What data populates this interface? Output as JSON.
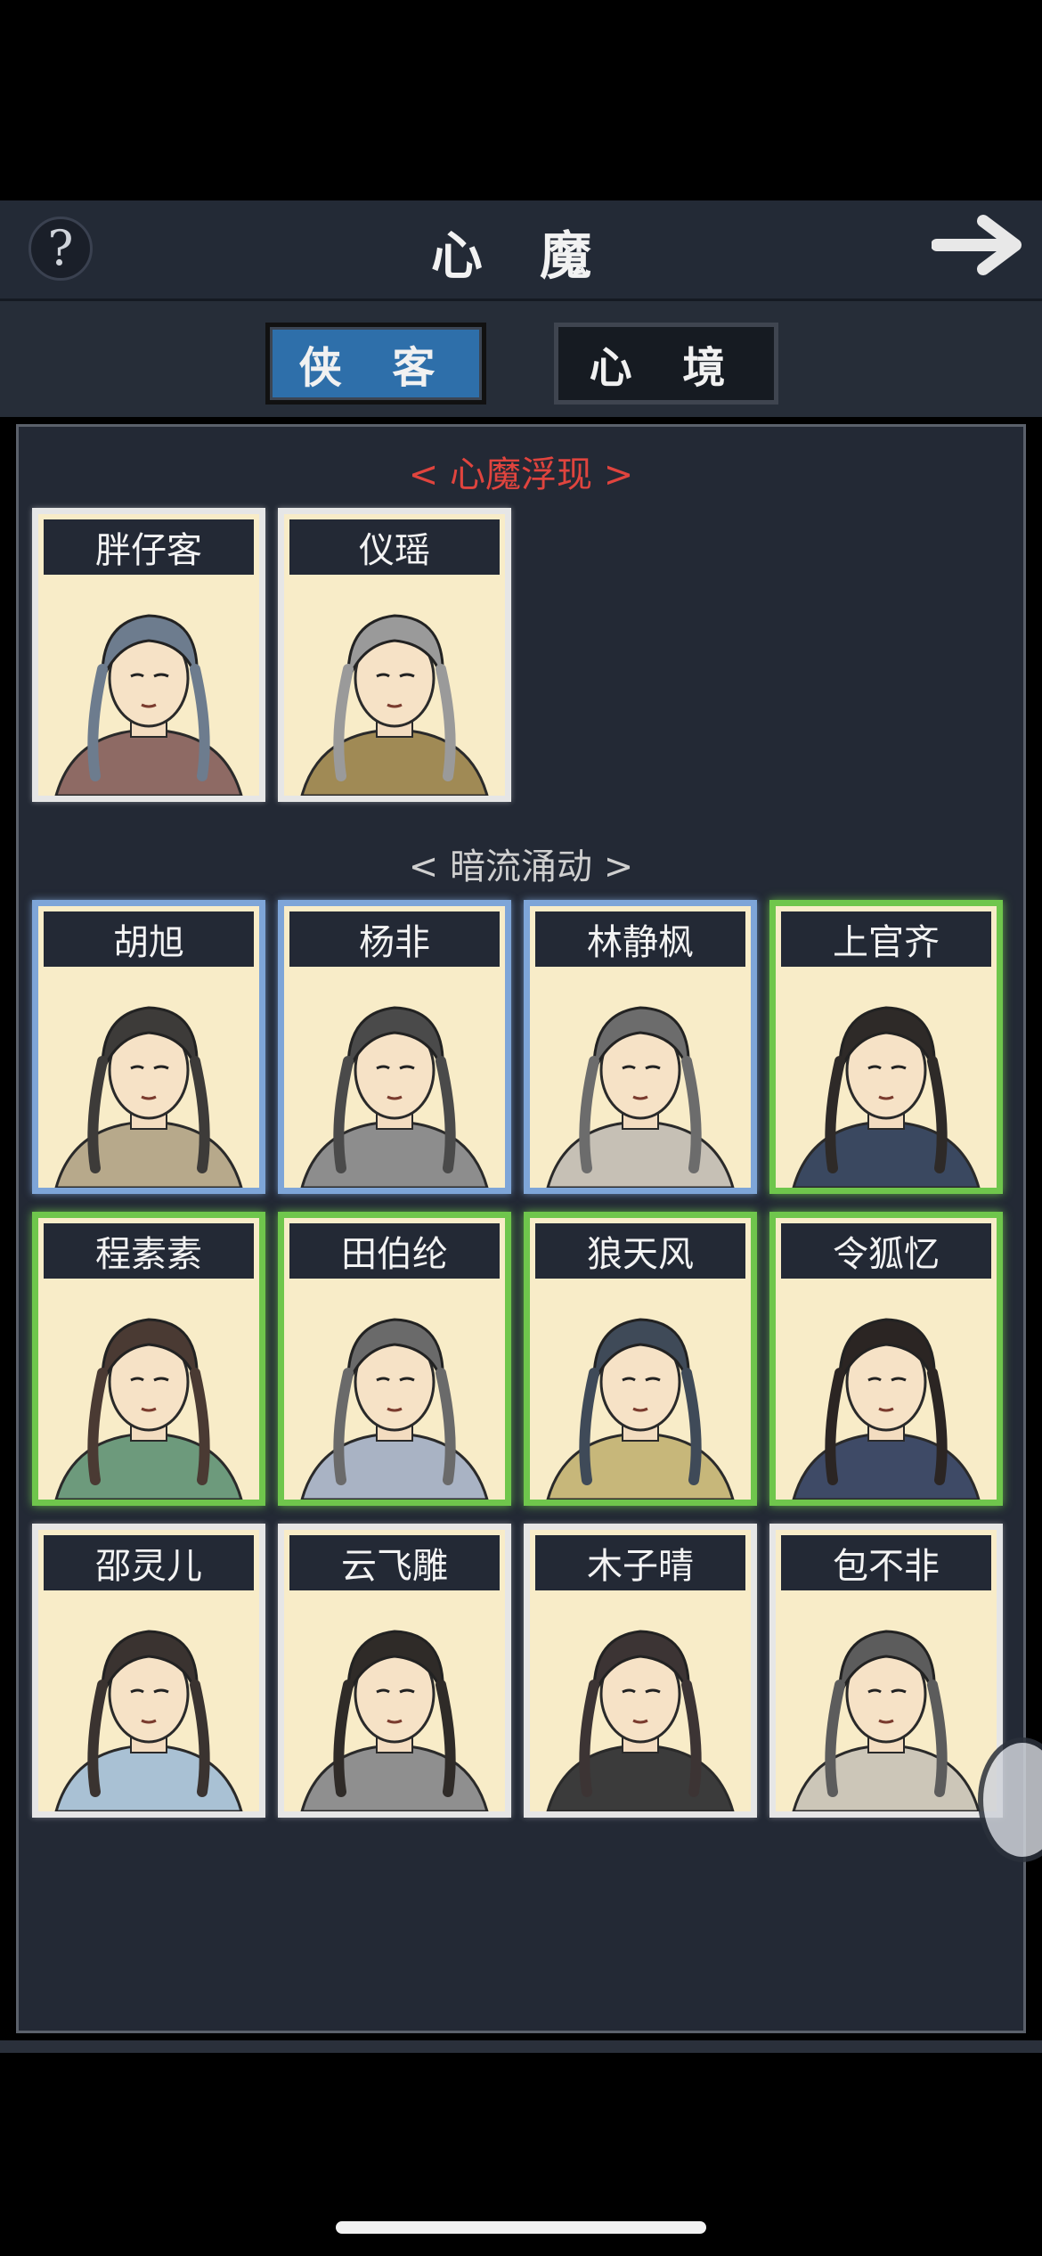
{
  "header": {
    "title": "心 魔"
  },
  "tabs": [
    {
      "label": "侠 客",
      "active": true
    },
    {
      "label": "心 境",
      "active": false
    }
  ],
  "sections": [
    {
      "title": "< 心魔浮现 >",
      "color": "#e0443e"
    },
    {
      "title": "< 暗流涌动 >",
      "color": "#cfcfcf"
    }
  ],
  "cards": [
    {
      "name": "胖仔客",
      "rarity": "white"
    },
    {
      "name": "仪瑶",
      "rarity": "white"
    },
    {
      "name": "胡旭",
      "rarity": "blue"
    },
    {
      "name": "杨非",
      "rarity": "blue"
    },
    {
      "name": "林静枫",
      "rarity": "blue"
    },
    {
      "name": "上官齐",
      "rarity": "green"
    },
    {
      "name": "程素素",
      "rarity": "green"
    },
    {
      "name": "田伯纶",
      "rarity": "green"
    },
    {
      "name": "狼天风",
      "rarity": "green"
    },
    {
      "name": "令狐忆",
      "rarity": "green"
    },
    {
      "name": "邵灵儿",
      "rarity": "white"
    },
    {
      "name": "云飞雕",
      "rarity": "white"
    },
    {
      "name": "木子晴",
      "rarity": "white"
    },
    {
      "name": "包不非",
      "rarity": "white"
    }
  ],
  "icons": {
    "help": "question-mark-icon",
    "next": "right-arrow-icon"
  },
  "help_glyph": "?"
}
